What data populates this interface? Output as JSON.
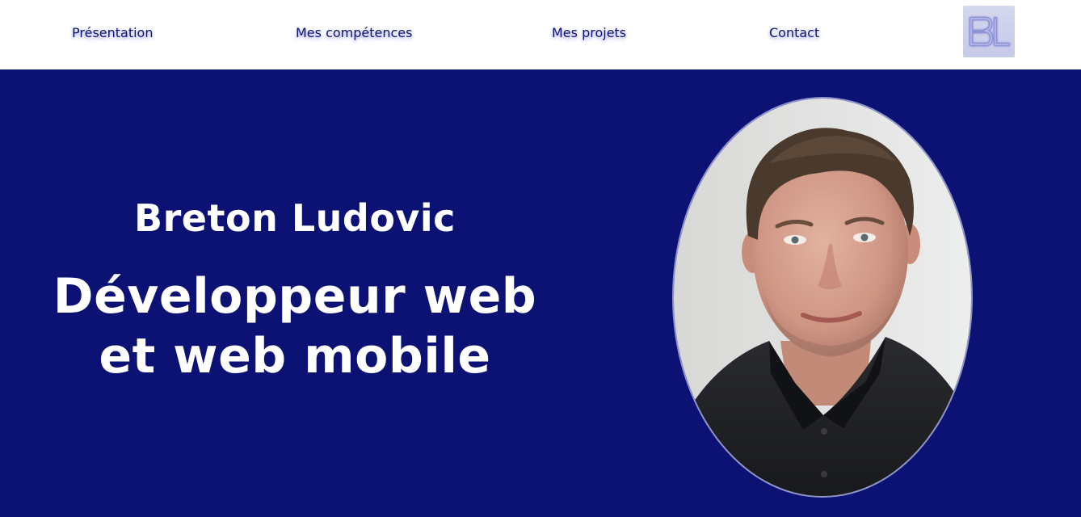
{
  "nav": {
    "items": [
      {
        "label": "Présentation"
      },
      {
        "label": "Mes compétences"
      },
      {
        "label": "Mes projets"
      },
      {
        "label": "Contact"
      }
    ],
    "logo_letters": "BL"
  },
  "hero": {
    "name": "Breton Ludovic",
    "title": "Développeur web et web mobile"
  },
  "colors": {
    "background": "#0c1274",
    "navbar": "#ffffff",
    "link": "#0c1274",
    "text": "#ffffff",
    "logo_accent": "#8f93d6"
  }
}
